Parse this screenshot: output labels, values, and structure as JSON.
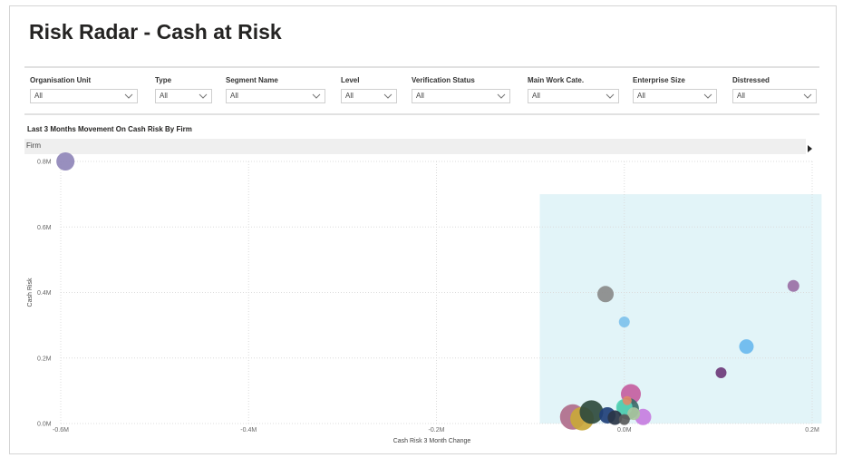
{
  "page": {
    "title": "Risk Radar - Cash at Risk"
  },
  "slicers": [
    {
      "label": "Organisation Unit",
      "value": "All"
    },
    {
      "label": "Type",
      "value": "All"
    },
    {
      "label": "Segment Name",
      "value": "All"
    },
    {
      "label": "Level",
      "value": "All"
    },
    {
      "label": "Verification Status",
      "value": "All"
    },
    {
      "label": "Main Work Cate.",
      "value": "All"
    },
    {
      "label": "Enterprise Size",
      "value": "All"
    },
    {
      "label": "Distressed",
      "value": "All"
    }
  ],
  "visual": {
    "title": "Last 3 Months Movement On Cash Risk By Firm",
    "legend_title": "Firm",
    "legend_scroll_icon": "caret-right-icon"
  },
  "chart_data": {
    "type": "scatter",
    "xlabel": "Cash Risk 3 Month Change",
    "ylabel": "Cash Risk",
    "xlim": [
      -0.6,
      0.2
    ],
    "ylim": [
      0,
      0.8
    ],
    "x_ticks": [
      "-0.6M",
      "-0.4M",
      "-0.2M",
      "0.0M",
      "0.2M"
    ],
    "y_ticks": [
      "0.0M",
      "0.2M",
      "0.4M",
      "0.6M",
      "0.8M"
    ],
    "grid": true,
    "highlight_region": {
      "x": [
        -0.09,
        0.21
      ],
      "y": [
        0,
        0.7
      ],
      "color": "#e2f4f8"
    },
    "points": [
      {
        "x": -0.595,
        "y": 0.8,
        "size": 20,
        "color": "#8f86b8"
      },
      {
        "x": -0.02,
        "y": 0.395,
        "size": 18,
        "color": "#8a8a8a"
      },
      {
        "x": 0.0,
        "y": 0.31,
        "size": 12,
        "color": "#7ec1ec"
      },
      {
        "x": 0.18,
        "y": 0.42,
        "size": 13,
        "color": "#9a6fa5"
      },
      {
        "x": 0.13,
        "y": 0.235,
        "size": 16,
        "color": "#6ab8ee"
      },
      {
        "x": 0.103,
        "y": 0.155,
        "size": 12,
        "color": "#6e3a7a"
      },
      {
        "x": 0.007,
        "y": 0.09,
        "size": 22,
        "color": "#c45ea0"
      },
      {
        "x": 0.02,
        "y": 0.02,
        "size": 18,
        "color": "#c77de0"
      },
      {
        "x": 0.004,
        "y": 0.045,
        "size": 24,
        "color": "#3d6b68"
      },
      {
        "x": 0.0,
        "y": 0.05,
        "size": 18,
        "color": "#57d6b8"
      },
      {
        "x": -0.055,
        "y": 0.02,
        "size": 28,
        "color": "#b06d8b"
      },
      {
        "x": -0.045,
        "y": 0.015,
        "size": 26,
        "color": "#c9a83a"
      },
      {
        "x": -0.035,
        "y": 0.035,
        "size": 26,
        "color": "#2f4a3d"
      },
      {
        "x": -0.018,
        "y": 0.025,
        "size": 18,
        "color": "#1f3f78"
      },
      {
        "x": -0.01,
        "y": 0.018,
        "size": 16,
        "color": "#2a3546"
      },
      {
        "x": 0.01,
        "y": 0.03,
        "size": 14,
        "color": "#a9c7a0"
      },
      {
        "x": 0.0,
        "y": 0.012,
        "size": 12,
        "color": "#5b5b5b"
      },
      {
        "x": 0.003,
        "y": 0.07,
        "size": 10,
        "color": "#e08a6a"
      }
    ]
  }
}
